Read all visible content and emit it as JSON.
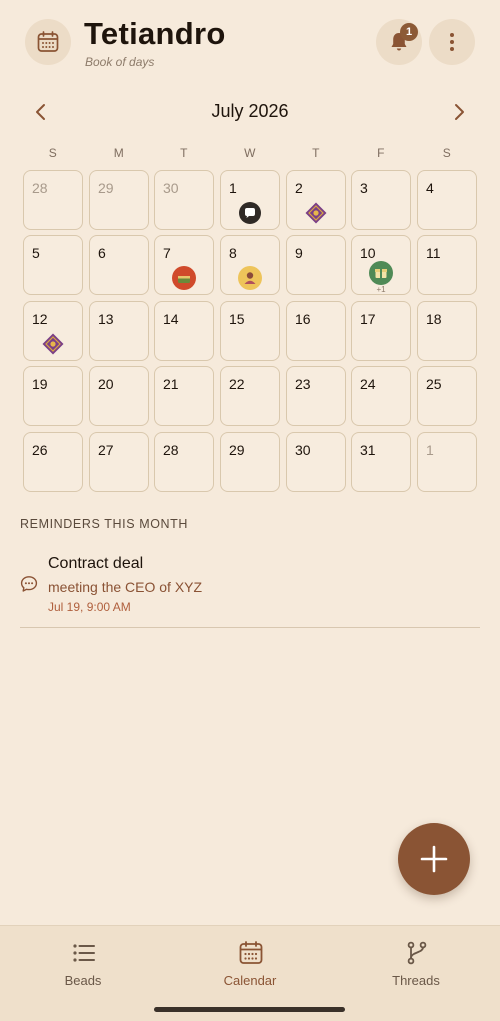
{
  "header": {
    "title": "Tetiandro",
    "subtitle": "Book of days",
    "notification_count": "1"
  },
  "month_nav": {
    "label": "July 2026"
  },
  "weekdays": [
    "S",
    "M",
    "T",
    "W",
    "T",
    "F",
    "S"
  ],
  "calendar": {
    "weeks": [
      [
        {
          "day": "28",
          "muted": true
        },
        {
          "day": "29",
          "muted": true
        },
        {
          "day": "30",
          "muted": true
        },
        {
          "day": "1",
          "event": "chat-bubble-icon"
        },
        {
          "day": "2",
          "event": "purple-diamond-icon"
        },
        {
          "day": "3"
        },
        {
          "day": "4"
        }
      ],
      [
        {
          "day": "5"
        },
        {
          "day": "6"
        },
        {
          "day": "7",
          "event": "red-cake-icon"
        },
        {
          "day": "8",
          "event": "yellow-person-icon"
        },
        {
          "day": "9"
        },
        {
          "day": "10",
          "event": "green-gift-icon",
          "more": "+1"
        },
        {
          "day": "11"
        }
      ],
      [
        {
          "day": "12",
          "event": "purple-diamond-icon"
        },
        {
          "day": "13"
        },
        {
          "day": "14"
        },
        {
          "day": "15"
        },
        {
          "day": "16"
        },
        {
          "day": "17"
        },
        {
          "day": "18"
        }
      ],
      [
        {
          "day": "19"
        },
        {
          "day": "20"
        },
        {
          "day": "21"
        },
        {
          "day": "22"
        },
        {
          "day": "23"
        },
        {
          "day": "24"
        },
        {
          "day": "25"
        }
      ],
      [
        {
          "day": "26"
        },
        {
          "day": "27"
        },
        {
          "day": "28"
        },
        {
          "day": "29"
        },
        {
          "day": "30"
        },
        {
          "day": "31"
        },
        {
          "day": "1",
          "muted": true
        }
      ]
    ]
  },
  "reminders": {
    "section_label": "REMINDERS THIS MONTH",
    "items": [
      {
        "title": "Contract deal",
        "description": "meeting the CEO of XYZ",
        "time": "Jul 19, 9:00 AM"
      }
    ]
  },
  "bottom_nav": {
    "items": [
      {
        "label": "Beads",
        "icon": "list-icon",
        "active": false
      },
      {
        "label": "Calendar",
        "icon": "calendar-icon",
        "active": true
      },
      {
        "label": "Threads",
        "icon": "branch-icon",
        "active": false
      }
    ]
  },
  "colors": {
    "background": "#f6eadb",
    "accent": "#8a5434",
    "cell_border": "#d9c8ad"
  }
}
